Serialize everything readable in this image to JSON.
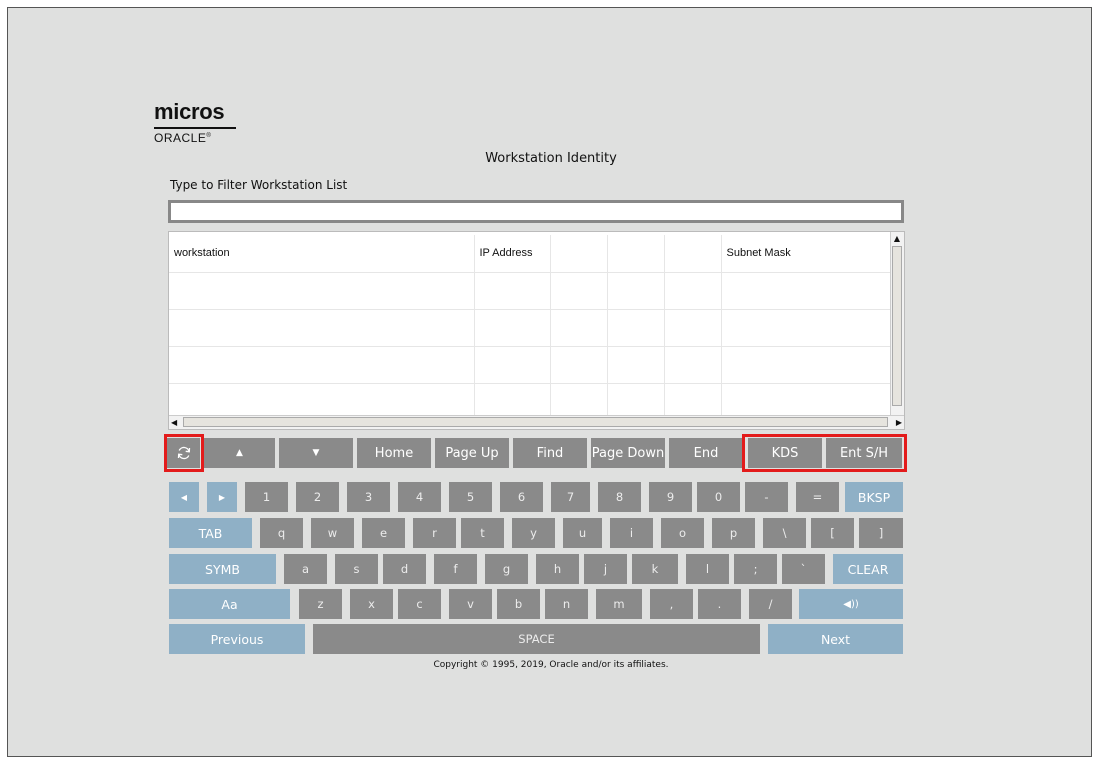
{
  "brand": {
    "line1": "micros",
    "line2": "ORACLE",
    "mark": "®"
  },
  "page_title": "Workstation Identity",
  "filter": {
    "label": "Type to Filter Workstation List",
    "value": "",
    "placeholder": ""
  },
  "grid": {
    "columns": [
      "workstation",
      "IP Address",
      "",
      "",
      "Subnet Mask"
    ],
    "rows": [
      [
        "",
        "",
        "",
        "",
        ""
      ],
      [
        "",
        "",
        "",
        "",
        ""
      ],
      [
        "",
        "",
        "",
        "",
        ""
      ],
      [
        "",
        "",
        "",
        "",
        ""
      ]
    ]
  },
  "navbar": {
    "refresh_icon": "refresh-icon",
    "up_icon": "arrow-up-icon",
    "up_glyph": "▲",
    "down_icon": "arrow-down-icon",
    "down_glyph": "▼",
    "home": "Home",
    "page_up": "Page Up",
    "find": "Find",
    "page_down": "Page Down",
    "end": "End",
    "kds": "KDS",
    "ent_sh": "Ent S/H"
  },
  "keyboard": {
    "row1": [
      "◀",
      "▶",
      "1",
      "2",
      "3",
      "4",
      "5",
      "6",
      "7",
      "8",
      "9",
      "0",
      "-",
      "=",
      "BKSP"
    ],
    "row2": [
      "TAB",
      "q",
      "w",
      "e",
      "r",
      "t",
      "y",
      "u",
      "i",
      "o",
      "p",
      "\\",
      "[",
      "]"
    ],
    "row3": [
      "SYMB",
      "a",
      "s",
      "d",
      "f",
      "g",
      "h",
      "j",
      "k",
      "l",
      ";",
      "`",
      "CLEAR"
    ],
    "row4": [
      "Aa",
      "z",
      "x",
      "c",
      "v",
      "b",
      "n",
      "m",
      ",",
      ".",
      "/",
      "◀))"
    ],
    "row5": [
      "Previous",
      "SPACE",
      "Next"
    ]
  },
  "copyright": "Copyright © 1995, 2019, Oracle and/or its affiliates.",
  "colors": {
    "key_gray": "#8a8a8a",
    "key_blue": "#8fb0c6",
    "highlight": "#e31b1b",
    "background": "#dfe0df"
  }
}
